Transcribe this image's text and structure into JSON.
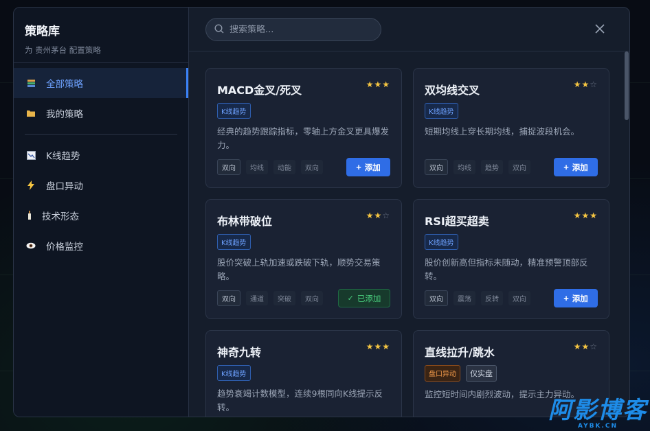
{
  "sidebar": {
    "title": "策略库",
    "subtitle": "为 贵州茅台 配置策略",
    "items": [
      {
        "label": "全部策略",
        "icon": "books-icon",
        "active": true
      },
      {
        "label": "我的策略",
        "icon": "folder-icon",
        "active": false
      },
      {
        "label": "K线趋势",
        "icon": "chart-icon",
        "active": false
      },
      {
        "label": "盘口异动",
        "icon": "lightning-icon",
        "active": false
      },
      {
        "label": "技术形态",
        "icon": "candle-icon",
        "active": false
      },
      {
        "label": "价格监控",
        "icon": "eye-icon",
        "active": false
      }
    ]
  },
  "search": {
    "placeholder": "搜索策略..."
  },
  "cards": [
    {
      "title": "MACD金叉/死叉",
      "rating": 3,
      "tags": [
        {
          "text": "K线趋势",
          "kind": "blue"
        }
      ],
      "desc": "经典的趋势跟踪指标，零轴上方金叉更具爆发力。",
      "meta": [
        "双向",
        "均线",
        "动能",
        "双向"
      ],
      "action": "添加",
      "added": false
    },
    {
      "title": "双均线交叉",
      "rating": 2,
      "tags": [
        {
          "text": "K线趋势",
          "kind": "blue"
        }
      ],
      "desc": "短期均线上穿长期均线，捕捉波段机会。",
      "meta": [
        "双向",
        "均线",
        "趋势",
        "双向"
      ],
      "action": "添加",
      "added": false
    },
    {
      "title": "布林带破位",
      "rating": 2,
      "tags": [
        {
          "text": "K线趋势",
          "kind": "blue"
        }
      ],
      "desc": "股价突破上轨加速或跌破下轨，顺势交易策略。",
      "meta": [
        "双向",
        "通道",
        "突破",
        "双向"
      ],
      "action": "已添加",
      "added": true
    },
    {
      "title": "RSI超买超卖",
      "rating": 3,
      "tags": [
        {
          "text": "K线趋势",
          "kind": "blue"
        }
      ],
      "desc": "股价创新高但指标未随动，精准预警顶部反转。",
      "meta": [
        "双向",
        "震荡",
        "反转",
        "双向"
      ],
      "action": "添加",
      "added": false
    },
    {
      "title": "神奇九转",
      "rating": 3,
      "tags": [
        {
          "text": "K线趋势",
          "kind": "blue"
        }
      ],
      "desc": "趋势衰竭计数模型，连续9根同向K线提示反转。",
      "meta": [],
      "action": "",
      "added": false
    },
    {
      "title": "直线拉升/跳水",
      "rating": 2,
      "tags": [
        {
          "text": "盘口异动",
          "kind": "orange"
        },
        {
          "text": "仅实盘",
          "kind": "gray"
        }
      ],
      "desc": "监控短时间内剧烈波动，提示主力异动。",
      "meta": [],
      "action": "",
      "added": false
    }
  ],
  "watermark": {
    "big": "阿影博客",
    "small": "AYBK.CN"
  }
}
